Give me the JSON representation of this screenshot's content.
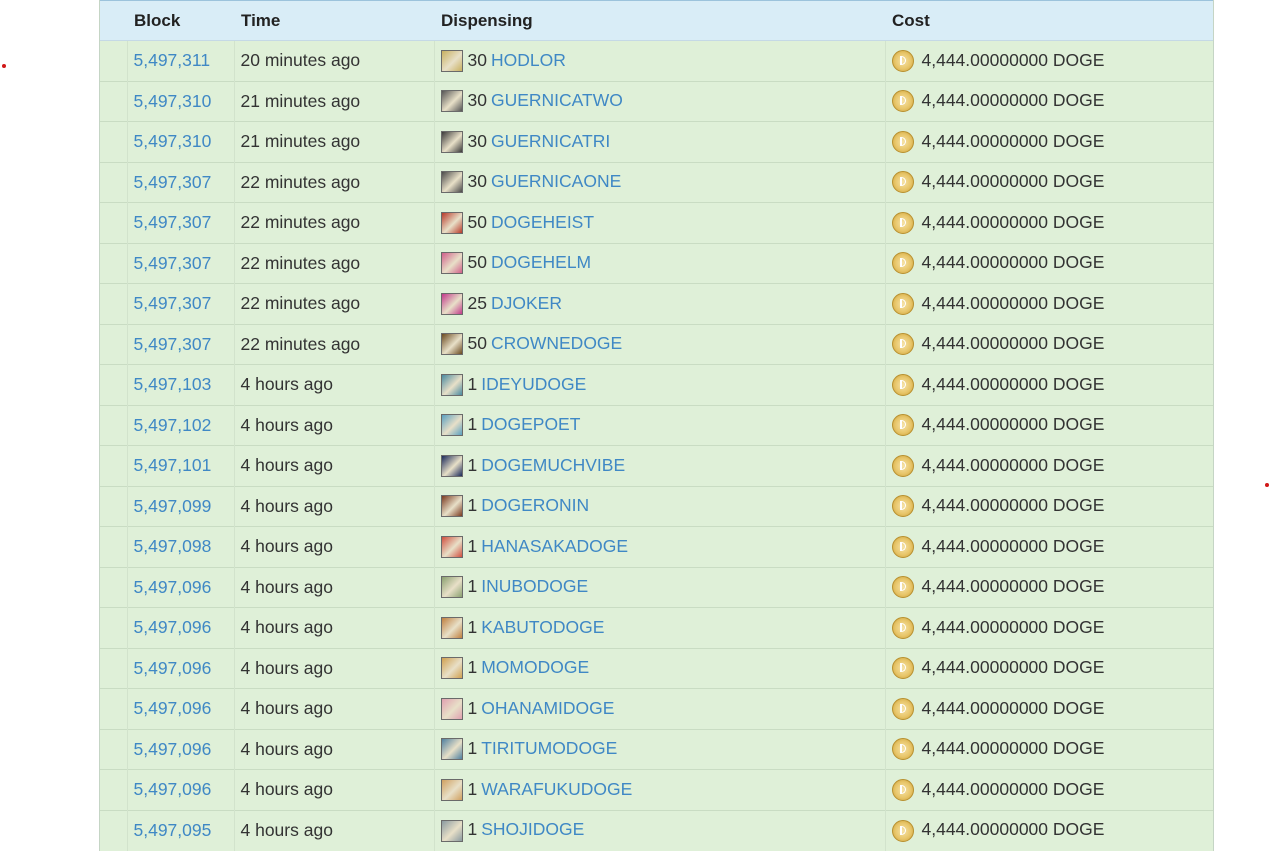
{
  "headers": {
    "block": "Block",
    "time": "Time",
    "dispensing": "Dispensing",
    "cost": "Cost"
  },
  "rows": [
    {
      "block": "5,497,311",
      "time": "20 minutes ago",
      "qty": "30",
      "asset": "HODLOR",
      "cost": "4,444.00000000 DOGE",
      "thumb_color": "#c8b060"
    },
    {
      "block": "5,497,310",
      "time": "21 minutes ago",
      "qty": "30",
      "asset": "GUERNICATWO",
      "cost": "4,444.00000000 DOGE",
      "thumb_color": "#555555"
    },
    {
      "block": "5,497,310",
      "time": "21 minutes ago",
      "qty": "30",
      "asset": "GUERNICATRI",
      "cost": "4,444.00000000 DOGE",
      "thumb_color": "#3a3a3a"
    },
    {
      "block": "5,497,307",
      "time": "22 minutes ago",
      "qty": "30",
      "asset": "GUERNICAONE",
      "cost": "4,444.00000000 DOGE",
      "thumb_color": "#4a4a4a"
    },
    {
      "block": "5,497,307",
      "time": "22 minutes ago",
      "qty": "50",
      "asset": "DOGEHEIST",
      "cost": "4,444.00000000 DOGE",
      "thumb_color": "#b83a2a"
    },
    {
      "block": "5,497,307",
      "time": "22 minutes ago",
      "qty": "50",
      "asset": "DOGEHELM",
      "cost": "4,444.00000000 DOGE",
      "thumb_color": "#d0608a"
    },
    {
      "block": "5,497,307",
      "time": "22 minutes ago",
      "qty": "25",
      "asset": "DJOKER",
      "cost": "4,444.00000000 DOGE",
      "thumb_color": "#c23a8a"
    },
    {
      "block": "5,497,307",
      "time": "22 minutes ago",
      "qty": "50",
      "asset": "CROWNEDOGE",
      "cost": "4,444.00000000 DOGE",
      "thumb_color": "#6a4a20"
    },
    {
      "block": "5,497,103",
      "time": "4 hours ago",
      "qty": "1",
      "asset": "IDEYUDOGE",
      "cost": "4,444.00000000 DOGE",
      "thumb_color": "#4a8aa0"
    },
    {
      "block": "5,497,102",
      "time": "4 hours ago",
      "qty": "1",
      "asset": "DOGEPOET",
      "cost": "4,444.00000000 DOGE",
      "thumb_color": "#5aa0c0"
    },
    {
      "block": "5,497,101",
      "time": "4 hours ago",
      "qty": "1",
      "asset": "DOGEMUCHVIBE",
      "cost": "4,444.00000000 DOGE",
      "thumb_color": "#1a2a5a"
    },
    {
      "block": "5,497,099",
      "time": "4 hours ago",
      "qty": "1",
      "asset": "DOGERONIN",
      "cost": "4,444.00000000 DOGE",
      "thumb_color": "#7a3a20"
    },
    {
      "block": "5,497,098",
      "time": "4 hours ago",
      "qty": "1",
      "asset": "HANASAKADOGE",
      "cost": "4,444.00000000 DOGE",
      "thumb_color": "#d05040"
    },
    {
      "block": "5,497,096",
      "time": "4 hours ago",
      "qty": "1",
      "asset": "INUBODOGE",
      "cost": "4,444.00000000 DOGE",
      "thumb_color": "#8aa070"
    },
    {
      "block": "5,497,096",
      "time": "4 hours ago",
      "qty": "1",
      "asset": "KABUTODOGE",
      "cost": "4,444.00000000 DOGE",
      "thumb_color": "#c08040"
    },
    {
      "block": "5,497,096",
      "time": "4 hours ago",
      "qty": "1",
      "asset": "MOMODOGE",
      "cost": "4,444.00000000 DOGE",
      "thumb_color": "#d0a050"
    },
    {
      "block": "5,497,096",
      "time": "4 hours ago",
      "qty": "1",
      "asset": "OHANAMIDOGE",
      "cost": "4,444.00000000 DOGE",
      "thumb_color": "#e0a0b0"
    },
    {
      "block": "5,497,096",
      "time": "4 hours ago",
      "qty": "1",
      "asset": "TIRITUMODOGE",
      "cost": "4,444.00000000 DOGE",
      "thumb_color": "#5080a0"
    },
    {
      "block": "5,497,096",
      "time": "4 hours ago",
      "qty": "1",
      "asset": "WARAFUKUDOGE",
      "cost": "4,444.00000000 DOGE",
      "thumb_color": "#d0a060"
    },
    {
      "block": "5,497,095",
      "time": "4 hours ago",
      "qty": "1",
      "asset": "SHOJIDOGE",
      "cost": "4,444.00000000 DOGE",
      "thumb_color": "#8a9aa0"
    }
  ],
  "colors": {
    "header_bg": "#d9edf7",
    "row_bg": "#dff0d8",
    "link": "#3f88c5",
    "marker_dot": "#d01818"
  },
  "icons": {
    "cost_icon": "doge-coin-icon",
    "asset_icon": "asset-thumbnail-icon"
  }
}
